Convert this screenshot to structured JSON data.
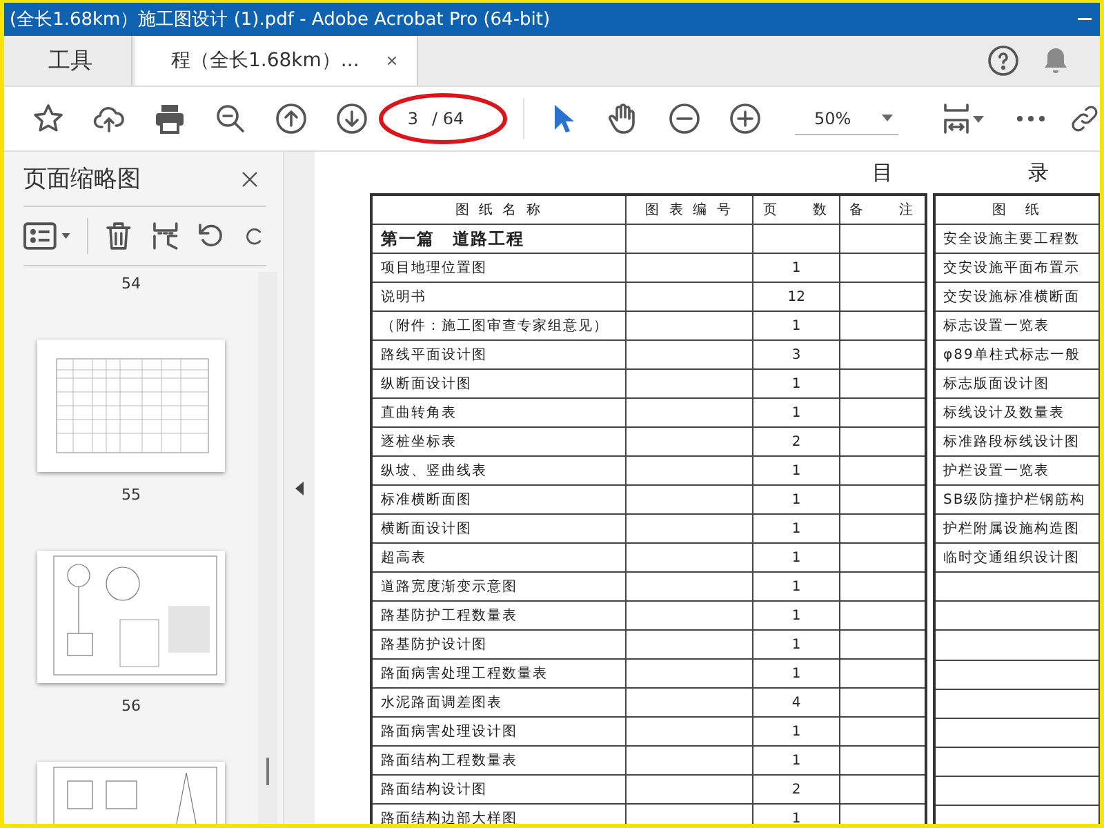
{
  "window": {
    "title": "(全长1.68km）施工图设计 (1).pdf - Adobe Acrobat Pro (64-bit)"
  },
  "tabs": [
    {
      "label": "工具",
      "selected": false
    },
    {
      "label": "程（全长1.68km）...",
      "selected": true
    }
  ],
  "toolbar": {
    "page_field": {
      "value": "3",
      "total": "/ 64"
    },
    "zoom": {
      "value": "50%"
    }
  },
  "thumbnails_panel": {
    "title": "页面缩略图",
    "page_labels": [
      "54",
      "55",
      "56"
    ],
    "thumbnails": [
      {
        "kind": "table"
      },
      {
        "kind": "drawing"
      },
      {
        "kind": "detail"
      }
    ]
  },
  "document": {
    "heading": [
      "目",
      "录"
    ],
    "left_table": {
      "columns": [
        "图 纸 名 称",
        "图 表 编 号",
        "页　　数",
        "备　　注"
      ],
      "rows": [
        {
          "kind": "section",
          "name": "第一篇　道路工程"
        },
        {
          "kind": "item",
          "name": "项目地理位置图",
          "pages": "1"
        },
        {
          "kind": "item",
          "name": "说明书",
          "pages": "12"
        },
        {
          "kind": "item",
          "name": "（附件：施工图审查专家组意见）",
          "pages": "1"
        },
        {
          "kind": "item",
          "name": "路线平面设计图",
          "pages": "3"
        },
        {
          "kind": "item",
          "name": "纵断面设计图",
          "pages": "1"
        },
        {
          "kind": "item",
          "name": "直曲转角表",
          "pages": "1"
        },
        {
          "kind": "item",
          "name": "逐桩坐标表",
          "pages": "2"
        },
        {
          "kind": "item",
          "name": "纵坡、竖曲线表",
          "pages": "1"
        },
        {
          "kind": "item",
          "name": "标准横断面图",
          "pages": "1"
        },
        {
          "kind": "item",
          "name": "横断面设计图",
          "pages": "1"
        },
        {
          "kind": "item",
          "name": "超高表",
          "pages": "1"
        },
        {
          "kind": "item",
          "name": "道路宽度渐变示意图",
          "pages": "1"
        },
        {
          "kind": "item",
          "name": "路基防护工程数量表",
          "pages": "1"
        },
        {
          "kind": "item",
          "name": "路基防护设计图",
          "pages": "1"
        },
        {
          "kind": "item",
          "name": "路面病害处理工程数量表",
          "pages": "1"
        },
        {
          "kind": "item",
          "name": "水泥路面调差图表",
          "pages": "4"
        },
        {
          "kind": "item",
          "name": "路面病害处理设计图",
          "pages": "1"
        },
        {
          "kind": "item",
          "name": "路面结构工程数量表",
          "pages": "1"
        },
        {
          "kind": "item",
          "name": "路面结构设计图",
          "pages": "2"
        },
        {
          "kind": "item",
          "name": "路面结构边部大样图",
          "pages": "1"
        }
      ]
    },
    "right_table": {
      "columns": [
        "图　纸"
      ],
      "rows": [
        "安全设施主要工程数",
        "交安设施平面布置示",
        "交安设施标准横断面",
        "标志设置一览表",
        "φ89单柱式标志一般",
        "标志版面设计图",
        "标线设计及数量表",
        "标准路段标线设计图",
        "护栏设置一览表",
        "SB级防撞护栏钢筋构",
        "护栏附属设施构造图",
        "临时交通组织设计图"
      ]
    }
  }
}
